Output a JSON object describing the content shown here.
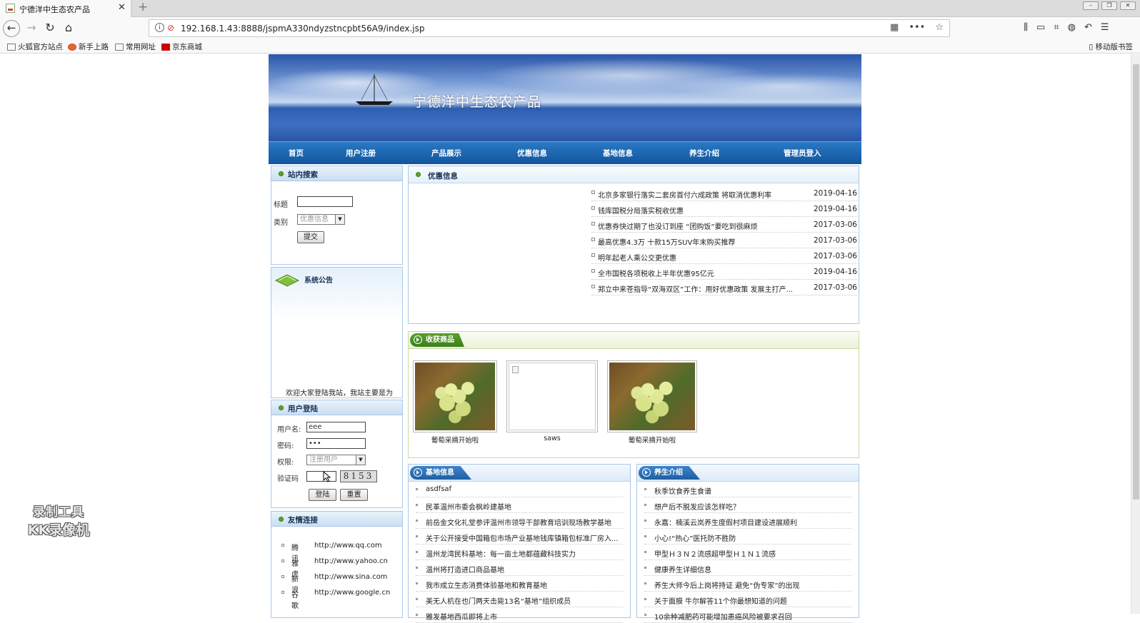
{
  "browser": {
    "tab_title": "宁德洋中生态农产品",
    "url": "192.168.1.43:8888/jspmA330ndyzstncpbt56A9/index.jsp",
    "bookmarks": [
      "火狐官方站点",
      "新手上路",
      "常用网址",
      "京东商城"
    ],
    "mobile_bookmarks": "移动版书签"
  },
  "site": {
    "banner_title": "宁德洋中生态农产品",
    "nav": [
      "首页",
      "用户注册",
      "产品展示",
      "优惠信息",
      "基地信息",
      "养生介绍",
      "管理员登入"
    ]
  },
  "search": {
    "title": "站内搜索",
    "label_title": "标题",
    "label_category": "类别",
    "category_value": "优惠信息",
    "submit": "提交"
  },
  "notice": {
    "title": "系统公告",
    "text": "欢迎大家登陆我站，我站主要是为"
  },
  "login": {
    "title": "用户登陆",
    "label_user": "用户名:",
    "user_value": "eee",
    "label_pass": "密码:",
    "pass_value": "•••",
    "label_role": "权限:",
    "role_value": "注册用户",
    "label_captcha": "验证码",
    "captcha_code": "8153",
    "btn_login": "登陆",
    "btn_reset": "重置"
  },
  "links": {
    "title": "友情连接",
    "items": [
      {
        "name": "腾讯",
        "url": "http://www.qq.com"
      },
      {
        "name": "雅虎",
        "url": "http://www.yahoo.cn"
      },
      {
        "name": "新浪",
        "url": "http://www.sina.com"
      },
      {
        "name": "谷歌",
        "url": "http://www.google.cn"
      }
    ]
  },
  "promos": {
    "title": "优惠信息",
    "items": [
      {
        "title": "北京多家银行落实二套房首付六成政策 将取消优惠利率",
        "date": "2019-04-16"
      },
      {
        "title": "钱库国税分局落实税收优惠",
        "date": "2019-04-16"
      },
      {
        "title": "优惠券快过期了也没订到座 “团购饭”要吃到很麻烦",
        "date": "2017-03-06"
      },
      {
        "title": "最高优惠4.3万 十款15万SUV年末购买推荐",
        "date": "2017-03-06"
      },
      {
        "title": "明年起老人乘公交更优惠",
        "date": "2017-03-06"
      },
      {
        "title": "全市国税各项税收上半年优惠95亿元",
        "date": "2019-04-16"
      },
      {
        "title": "郑立中来苍指导“双海双区”工作：用好优惠政策 发展主打产...",
        "date": "2017-03-06"
      }
    ]
  },
  "products": {
    "title": "收获商品",
    "items": [
      {
        "name": "葡萄采摘开始啦",
        "image": "grape"
      },
      {
        "name": "saws",
        "image": "broken-image"
      },
      {
        "name": "葡萄采摘开始啦",
        "image": "grape"
      }
    ]
  },
  "bases": {
    "title": "基地信息",
    "items": [
      "asdfsaf",
      "民革温州市委会枫岭建基地",
      "前岳金文化礼堂参评温州市领导干部教育培训现场教学基地",
      "关于公开接受中国箱包市场产业基地钱库镇箱包标准厂房入...",
      "温州龙湾民科基地：每一亩土地都蕴藏科技实力",
      "温州将打造进口商品基地",
      "我市成立生态消费体验基地和教育基地",
      "美无人机在也门两天击毙13名“基地”组织成员",
      "雅发基地西瓜即将上市"
    ]
  },
  "health": {
    "title": "养生介绍",
    "items": [
      "秋季饮食养生食谱",
      "想产后不脱发应该怎样吃？",
      "永嘉：楠溪云岚养生度假村项目建设进展顺利",
      "小心!“热心”医托防不胜防",
      "甲型Ｈ３Ｎ２流感超甲型Ｈ１Ｎ１流感",
      "健康养生详细信息",
      "养生大师今后上岗将持证 避免“伪专家”的出现",
      "关于面膜 牛尔解答11个你最想知道的问题",
      "10余种减肥药可能增加患癌风险被要求召回"
    ]
  },
  "watermark": {
    "line1": "录制工具",
    "line2": "KK录像机"
  },
  "colors": {
    "nav_blue": "#11559e",
    "box_border": "#a9c9e8",
    "green_accent": "#3c7f1a"
  }
}
